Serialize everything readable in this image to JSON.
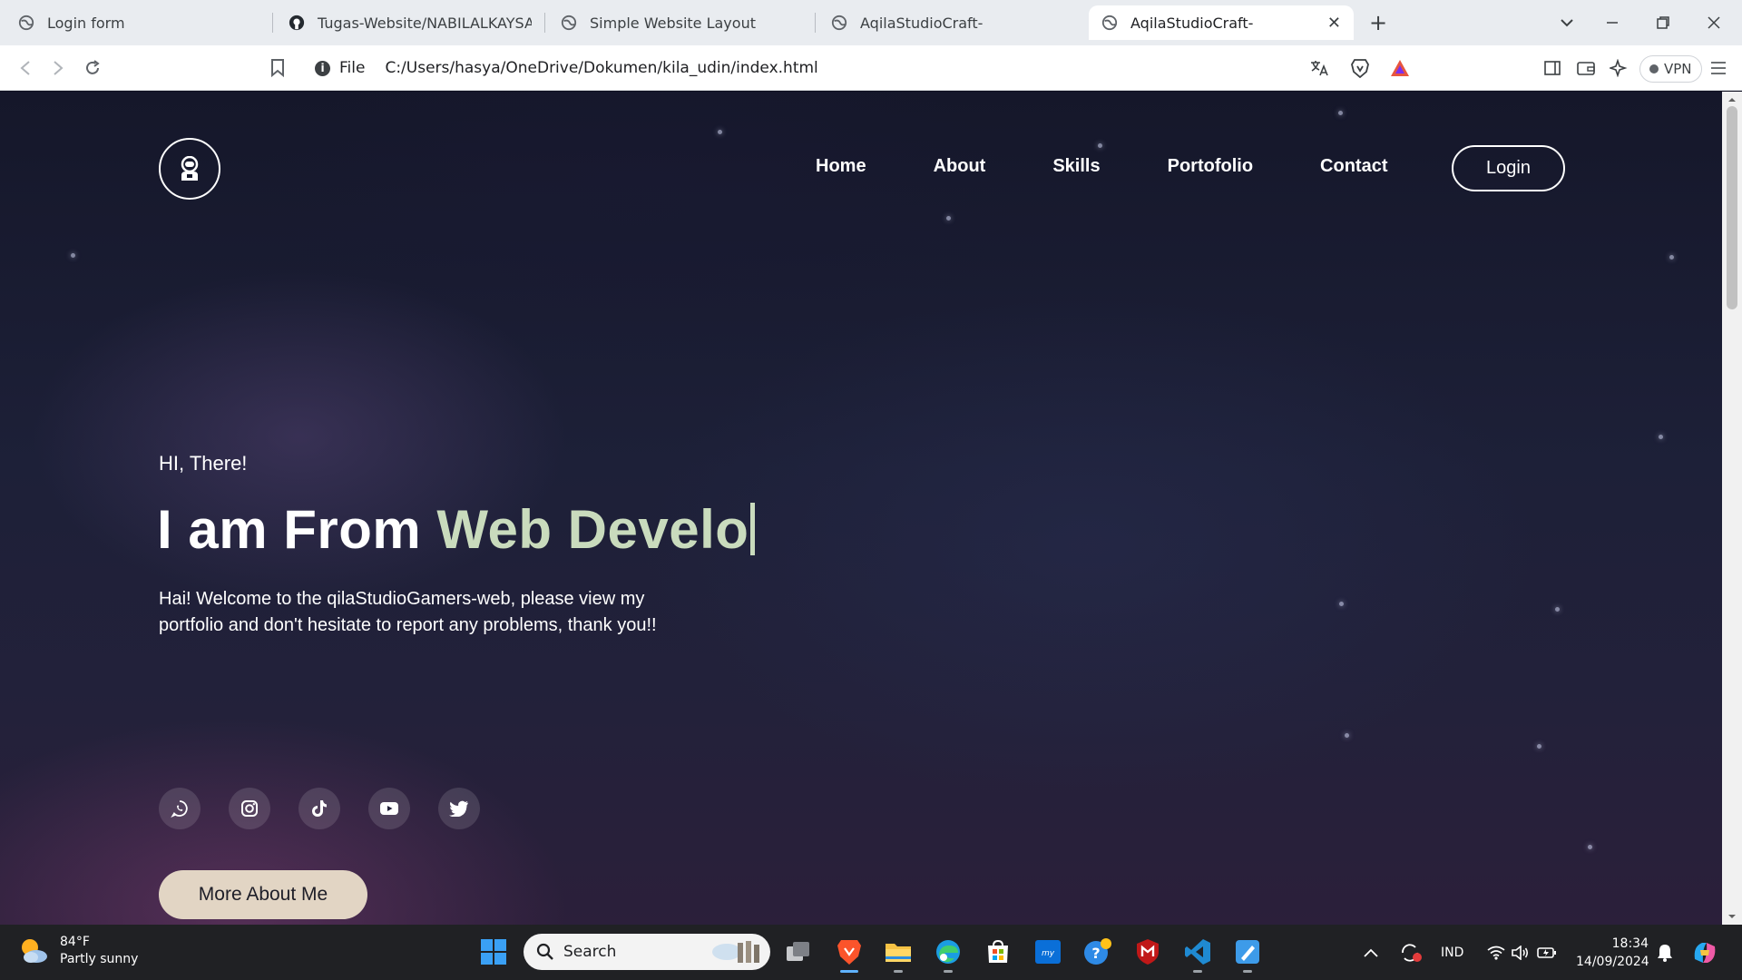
{
  "browser": {
    "tabs": [
      {
        "title": "Login form",
        "active": false
      },
      {
        "title": "Tugas-Website/NABILALKAYSAN.jpg",
        "active": false
      },
      {
        "title": "Simple Website Layout",
        "active": false
      },
      {
        "title": "AqilaStudioCraft-",
        "active": false
      },
      {
        "title": "AqilaStudioCraft-",
        "active": true
      }
    ],
    "address": {
      "scheme_label": "File",
      "url": "C:/Users/hasya/OneDrive/Dokumen/kila_udin/index.html"
    },
    "vpn_label": "VPN"
  },
  "site": {
    "nav": [
      "Home",
      "About",
      "Skills",
      "Portofolio",
      "Contact"
    ],
    "login_label": "Login",
    "greeting": "HI, There!",
    "headline_prefix": "I am From",
    "headline_typed": "Web Develo",
    "intro": "Hai! Welcome to the qilaStudioGamers-web, please view my portfolio and don't hesitate to report any problems, thank you!!",
    "socials": [
      "whatsapp-icon",
      "instagram-icon",
      "tiktok-icon",
      "youtube-icon",
      "twitter-icon"
    ],
    "cta_label": "More About Me",
    "colors": {
      "accent": "#c9dbbd",
      "cta_bg": "#e2d5c4"
    }
  },
  "taskbar": {
    "weather": {
      "temp": "84°F",
      "desc": "Partly sunny"
    },
    "search_placeholder": "Search",
    "language": "IND",
    "time": "18:34",
    "date": "14/09/2024"
  }
}
